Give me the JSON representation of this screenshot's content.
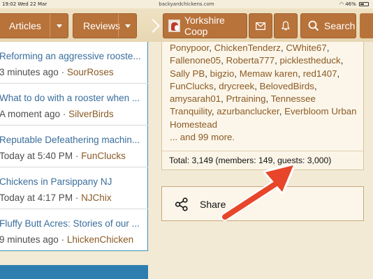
{
  "status_bar": {
    "time": "19:02  Wed 22 Mar",
    "url": "backyardchickens.com",
    "battery": "46%"
  },
  "nav": {
    "articles_label": "Articles",
    "reviews_label": "Reviews",
    "coop_label": "Yorkshire Coop",
    "search_label": "Search"
  },
  "threads": [
    {
      "title": "Reforming an aggressive rooste...",
      "time": "3 minutes ago",
      "user": "SourRoses"
    },
    {
      "title": "What to do with a rooster when ...",
      "time": "A moment ago",
      "user": "SilverBirds"
    },
    {
      "title": "Reputable Defeathering machin...",
      "time": "Today at 5:40 PM",
      "user": "FunClucks"
    },
    {
      "title": "Chickens in Parsippany NJ",
      "time": "Today at 4:17 PM",
      "user": "NJChix"
    },
    {
      "title": "Fluffy Butt Acres: Stories of our ...",
      "time": "9 minutes ago",
      "user": "LhickenChicken"
    }
  ],
  "online": {
    "names": [
      "Ponypoor",
      "ChickenTenderz",
      "CWhite67",
      "Fallenone05",
      "Roberta777",
      "picklestheduck",
      "Sally PB",
      "bigzio",
      "Memaw karen",
      "red1407",
      "FunClucks",
      "drycreek",
      "BelovedBirds",
      "amysarah01",
      "Prtraining",
      "Tennessee Tranquility",
      "azurbanclucker",
      "Everbloom Urban Homestead"
    ],
    "more": "... and 99 more.",
    "total": "Total: 3,149 (members: 149, guests: 3,000)"
  },
  "share": {
    "label": "Share"
  },
  "colors": {
    "nav_button": "#b8733a",
    "link_blue": "#3a6e9c",
    "link_brown": "#8a5a24",
    "arrow_red": "#e8462a",
    "panel_border_blue": "#3b8fb8"
  }
}
